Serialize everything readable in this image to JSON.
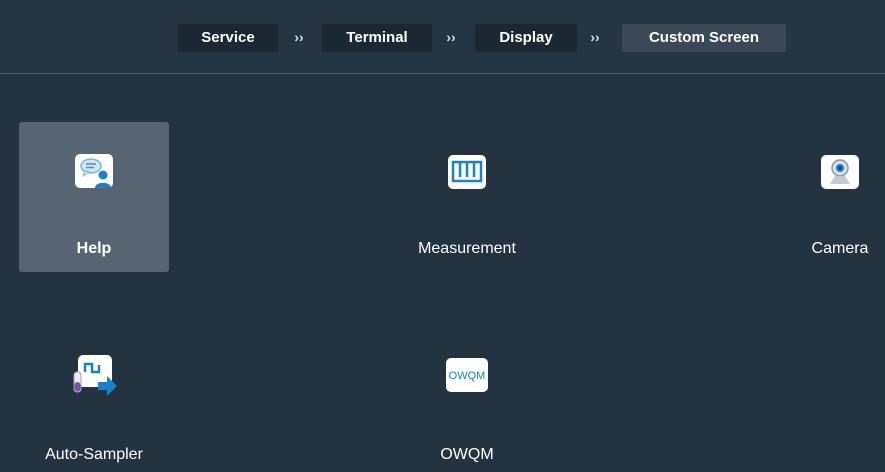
{
  "breadcrumb": {
    "items": [
      {
        "label": "Service"
      },
      {
        "label": "Terminal"
      },
      {
        "label": "Display"
      },
      {
        "label": "Custom Screen"
      }
    ],
    "separator": "››"
  },
  "tiles": [
    {
      "label": "Help",
      "icon": "help-chat-icon",
      "selected": true
    },
    {
      "label": "Measurement",
      "icon": "measurement-icon",
      "selected": false
    },
    {
      "label": "Camera",
      "icon": "camera-icon",
      "selected": false
    },
    {
      "label": "Auto-Sampler",
      "icon": "auto-sampler-icon",
      "selected": false
    },
    {
      "label": "OWQM",
      "icon": "owqm-icon",
      "icon_text": "OWQM",
      "selected": false
    }
  ],
  "colors": {
    "background": "#243340",
    "selected_tile": "#566571",
    "accent_blue": "#1a80c8"
  }
}
